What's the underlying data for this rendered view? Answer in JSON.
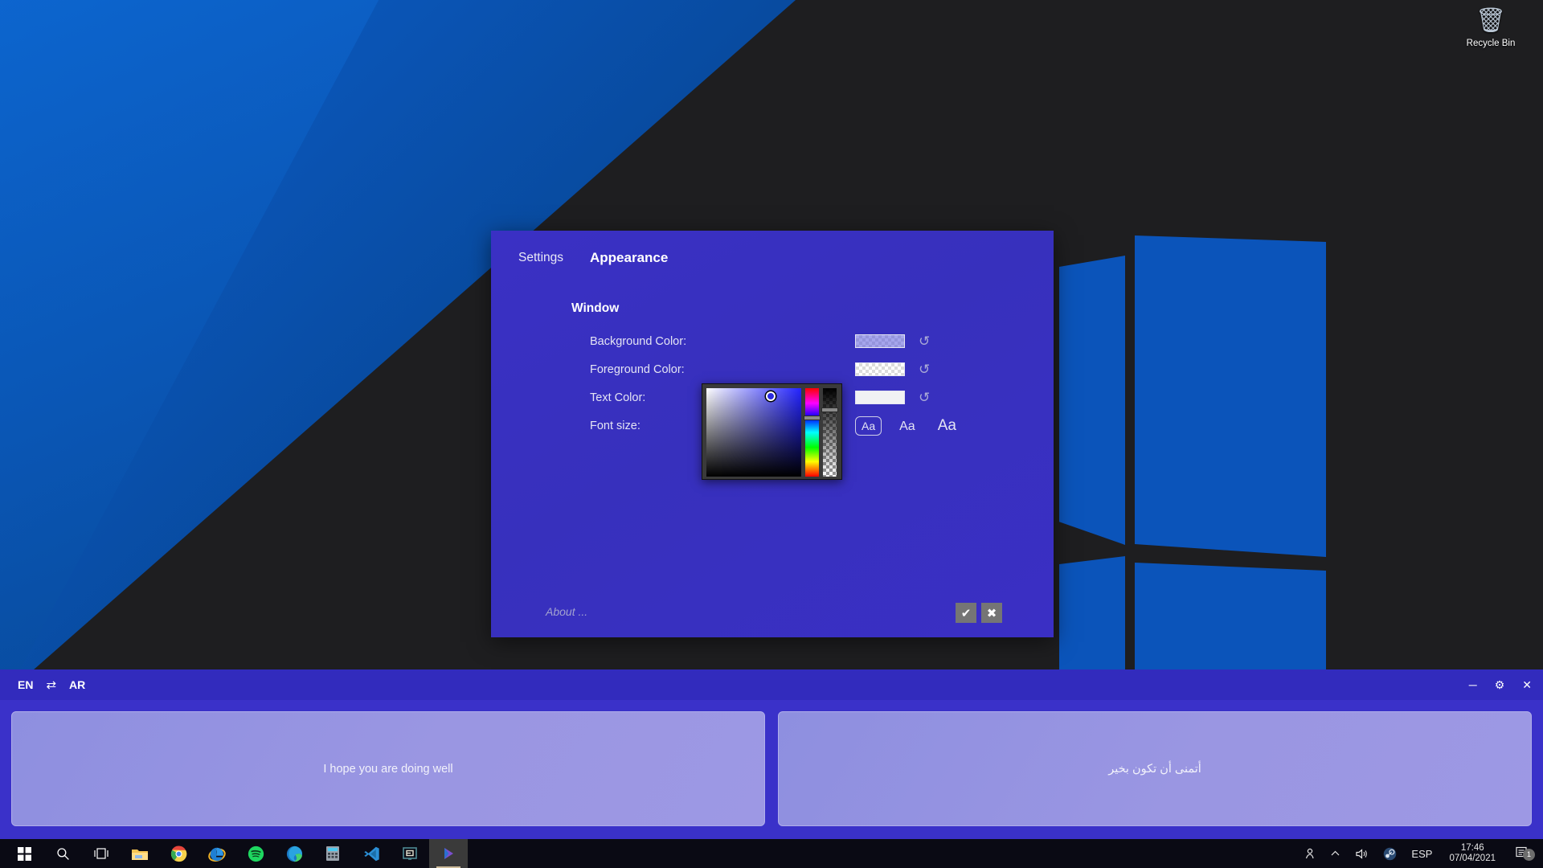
{
  "desktop": {
    "recycle_bin": {
      "label": "Recycle Bin",
      "icon": "recycle-bin-icon"
    }
  },
  "settings_dialog": {
    "tabs": [
      {
        "label": "Settings",
        "active": false
      },
      {
        "label": "Appearance",
        "active": true
      }
    ],
    "section_title": "Window",
    "rows": [
      {
        "label": "Background Color:",
        "control": "swatch",
        "swatch_color": "#5b5bdc",
        "swatch_alpha": 0.55,
        "reset_icon": "reset-arrow-icon"
      },
      {
        "label": "Foreground Color:",
        "control": "swatch",
        "swatch_color": "#ffffff",
        "swatch_alpha": 0.0,
        "reset_icon": "reset-arrow-icon"
      },
      {
        "label": "Text Color:",
        "control": "swatch",
        "swatch_color": "#f1f1f4",
        "swatch_alpha": 1.0,
        "reset_icon": "reset-arrow-icon"
      },
      {
        "label": "Font size:",
        "control": "font-size-group"
      }
    ],
    "font_sizes": [
      {
        "label": "Aa",
        "selected": true
      },
      {
        "label": "Aa",
        "selected": false
      },
      {
        "label": "Aa",
        "selected": false
      }
    ],
    "color_picker": {
      "visible": true,
      "sv_gradient_base": "#2323ff",
      "cursor_color": "#2b2be0",
      "hue_thumb_label": "hue-slider-thumb",
      "alpha_thumb_label": "alpha-slider-thumb"
    },
    "about_label": "About ...",
    "actions": [
      {
        "label": "✔",
        "name": "confirm"
      },
      {
        "label": "✖",
        "name": "cancel"
      }
    ]
  },
  "translator": {
    "source_lang": "EN",
    "target_lang": "AR",
    "swap_icon": "swap-arrows-icon",
    "window_controls": [
      {
        "glyph": "─",
        "name": "minimize"
      },
      {
        "glyph": "⚙",
        "name": "settings"
      },
      {
        "glyph": "✕",
        "name": "close"
      }
    ],
    "source_text": "I hope you are doing well",
    "target_text": "أتمنى أن تكون بخير"
  },
  "taskbar": {
    "items": [
      {
        "name": "start-button",
        "icon": "windows-logo-icon",
        "active": false
      },
      {
        "name": "search-button",
        "icon": "search-icon",
        "active": false
      },
      {
        "name": "task-view-button",
        "icon": "task-view-icon",
        "active": false
      },
      {
        "name": "file-explorer",
        "icon": "folder-icon",
        "active": false
      },
      {
        "name": "google-chrome",
        "icon": "chrome-icon",
        "active": false
      },
      {
        "name": "internet-explorer",
        "icon": "internet-explorer-icon",
        "active": false
      },
      {
        "name": "spotify",
        "icon": "spotify-icon",
        "active": false
      },
      {
        "name": "microsoft-edge",
        "icon": "edge-icon",
        "active": false
      },
      {
        "name": "calculator",
        "icon": "calculator-icon",
        "active": false
      },
      {
        "name": "visual-studio-code",
        "icon": "vscode-icon",
        "active": false
      },
      {
        "name": "editor-app",
        "icon": "editor-icon",
        "active": false
      },
      {
        "name": "media-player-app",
        "icon": "play-triangle-icon",
        "active": true
      }
    ],
    "tray": {
      "people_icon": "people-icon",
      "chevron_icon": "chevron-up-icon",
      "volume_icon": "volume-icon",
      "steam_icon": "steam-icon",
      "language": "ESP",
      "time": "17:46",
      "date": "07/04/2021",
      "notification_icon": "notification-icon",
      "notification_count": "1"
    }
  }
}
